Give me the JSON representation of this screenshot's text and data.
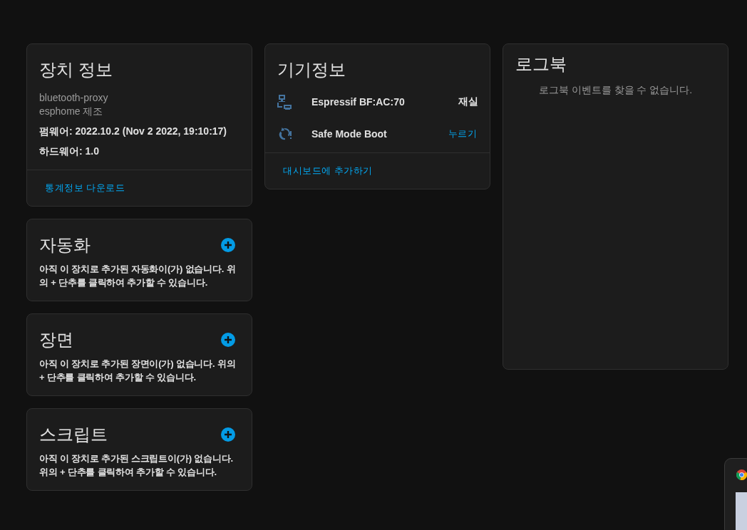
{
  "device_info": {
    "title": "장치 정보",
    "model": "bluetooth-proxy",
    "manufacturer": "esphome 제조",
    "firmware": "펌웨어: 2022.10.2 (Nov 2 2022, 19:10:17)",
    "hardware": "하드웨어: 1.0",
    "action": "통계정보 다운로드"
  },
  "controls": {
    "title": "기기정보",
    "entities": [
      {
        "kind": "sensor",
        "name": "Espressif BF:AC:70",
        "value": "재실"
      },
      {
        "kind": "button",
        "name": "Safe Mode Boot",
        "action": "누르기"
      }
    ],
    "action": "대시보드에 추가하기"
  },
  "sections": [
    {
      "title": "자동화",
      "message": "아직 이 장치로 추가된 자동화이(가) 없습니다. 위의 + 단추를 클릭하여 추가할 수 있습니다."
    },
    {
      "title": "장면",
      "message": "아직 이 장치로 추가된 장면이(가) 없습니다. 위의 + 단추를 클릭하여 추가할 수 있습니다."
    },
    {
      "title": "스크립트",
      "message": "아직 이 장치로 추가된 스크립트이(가) 없습니다. 위의 + 단추를 클릭하여 추가할 수 있습니다."
    }
  ],
  "logbook": {
    "title": "로그북",
    "message": "로그북 이벤트를 찾을 수 없습니다."
  }
}
